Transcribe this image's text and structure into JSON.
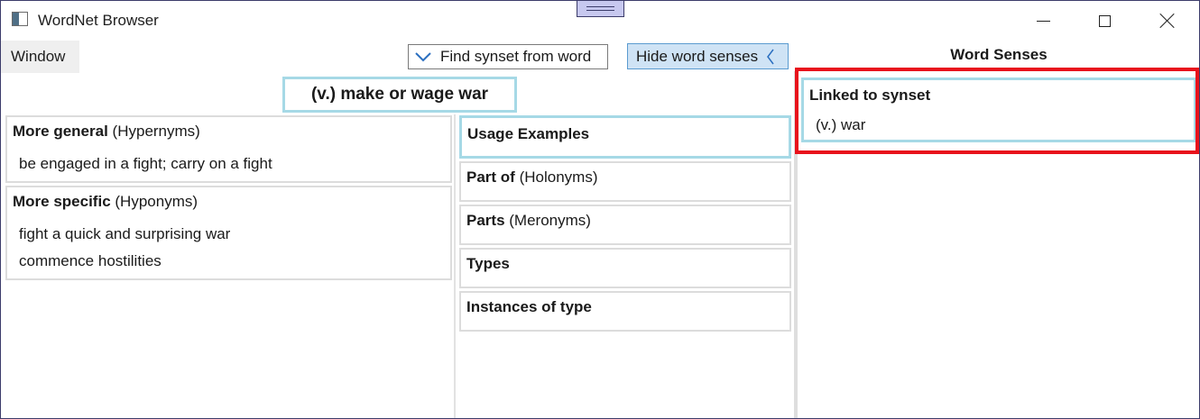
{
  "window": {
    "title": "WordNet Browser",
    "menu": [
      "Window"
    ]
  },
  "toolbar": {
    "find_label": "Find synset from word",
    "hide_label": "Hide word senses"
  },
  "synset": {
    "title": "(v.) make or wage war"
  },
  "relations": {
    "hypernyms": {
      "label": "More general",
      "sublabel": "(Hypernyms)",
      "items": [
        "be engaged in a fight; carry on a fight"
      ]
    },
    "hyponyms": {
      "label": "More specific",
      "sublabel": "(Hyponyms)",
      "items": [
        "fight a quick and surprising war",
        "commence hostilities"
      ]
    },
    "usage_examples": {
      "label": "Usage Examples"
    },
    "holonyms": {
      "label": "Part of",
      "sublabel": "(Holonyms)"
    },
    "meronyms": {
      "label": "Parts",
      "sublabel": "(Meronyms)"
    },
    "types": {
      "label": "Types"
    },
    "instances": {
      "label": "Instances of type"
    }
  },
  "word_senses": {
    "header": "Word Senses",
    "linked_label": "Linked to synset",
    "items": [
      "(v.) war"
    ]
  },
  "colors": {
    "accent_border": "#a6d9e6",
    "highlight": "#e8121c",
    "hide_button_bg": "#cfe3f5",
    "drag_handle": "#c7c8ef"
  }
}
